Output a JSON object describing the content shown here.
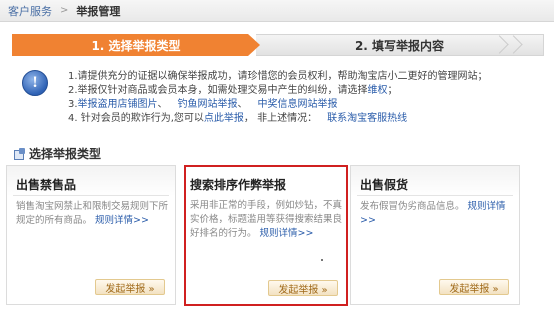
{
  "breadcrumb": {
    "link": "客户服务",
    "separator": ">",
    "current": "举报管理"
  },
  "steps": {
    "step1": "1. 选择举报类型",
    "step2": "2. 填写举报内容"
  },
  "notice": {
    "icon": "info-icon",
    "line1": "1.请提供充分的证据以确保举报成功，请珍惜您的会员权利，帮助淘宝店小二更好的管理网站；",
    "line2_text": "2.举报仅针对商品或会员本身，如需处理交易中产生的纠纷，请选择",
    "line2_link": "维权",
    "line2_end": "；",
    "line3_prefix": "3.",
    "line3_link1": "举报盗用店铺图片",
    "line3_link2": "钓鱼网站举报",
    "line3_link3": "中奖信息网站举报",
    "line3_sep": "、",
    "line4_text1": "4. 针对会员的欺诈行为,您可以",
    "line4_link1": "点此举报",
    "line4_text2": "， 非上述情况：",
    "line4_link2": "联系淘宝客服热线"
  },
  "section": {
    "title": "选择举报类型"
  },
  "cards": [
    {
      "title": "出售禁售品",
      "desc": "销售淘宝网禁止和限制交易规则下所规定的所有商品。",
      "link": "规则详情>>",
      "button": "发起举报 »"
    },
    {
      "title": "搜索排序作弊举报",
      "desc": "采用非正常的手段，例如炒钻，不真实价格，标题滥用等获得搜索结果良好排名的行为。",
      "link": "规则详情>>",
      "button": "发起举报 »"
    },
    {
      "title": "出售假货",
      "desc": "发布假冒伪劣商品信息。",
      "link": "规则详情>>",
      "button": "发起举报 »"
    }
  ],
  "colors": {
    "step_active": "#f08232",
    "highlight_border": "#d02020",
    "link": "#2a5caa"
  }
}
